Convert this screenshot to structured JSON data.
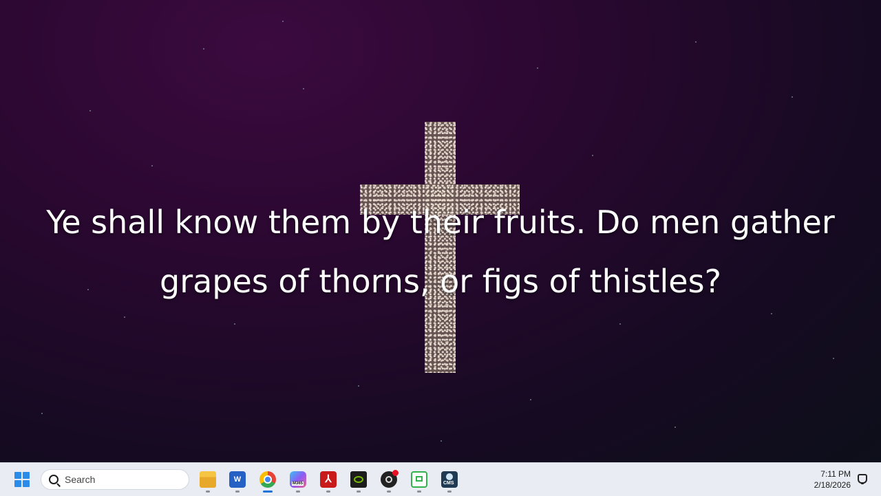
{
  "desktop": {
    "verse": "Ye shall know them by their fruits. Do men gather grapes of thorns, or figs of thistles?"
  },
  "taskbar": {
    "search": {
      "placeholder": "Search"
    },
    "apps": [
      {
        "name": "File Explorer",
        "icon": "folder-icon"
      },
      {
        "name": "Word",
        "icon": "word-icon",
        "glyph": "W"
      },
      {
        "name": "Google Chrome",
        "icon": "chrome-icon"
      },
      {
        "name": "Microsoft 365",
        "icon": "m365-icon",
        "badge": "M365"
      },
      {
        "name": "Adobe Acrobat",
        "icon": "acrobat-icon"
      },
      {
        "name": "NVIDIA",
        "icon": "nvidia-icon"
      },
      {
        "name": "OBS Studio",
        "icon": "obs-icon"
      },
      {
        "name": "Screen Recorder",
        "icon": "screen-recorder-icon"
      },
      {
        "name": "CMS",
        "icon": "cms-icon",
        "badge": "CMS"
      }
    ],
    "clock": {
      "time": "7:11 PM",
      "date": "2/18/2026"
    }
  },
  "colors": {
    "taskbar_bg": "#e9ecf3",
    "accent": "#1a73d9",
    "verse_text": "#ffffff"
  }
}
